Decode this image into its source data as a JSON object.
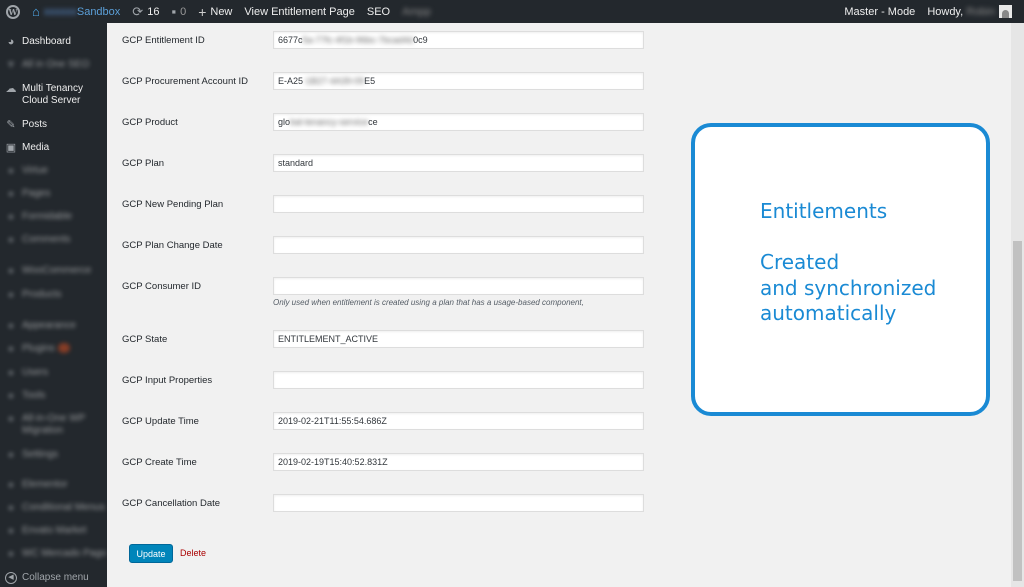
{
  "adminbar": {
    "site_name": "Sandbox",
    "updates_count": "16",
    "comments_count": "0",
    "new_label": "New",
    "view_page_label": "View Entitlement Page",
    "seo_label": "SEO",
    "blurred_item": "Ampp",
    "mode_label": "Master - Mode",
    "howdy_label": "Howdy,",
    "username": "Robin"
  },
  "sidebar": {
    "items": [
      {
        "label": "Dashboard",
        "icon": "dashboard-icon"
      },
      {
        "label": "All in One SEO",
        "icon": "shield-icon"
      },
      {
        "label": "Multi Tenancy Cloud Server",
        "icon": "cloud-icon"
      },
      {
        "label": "Posts",
        "icon": "pin-icon"
      },
      {
        "label": "Media",
        "icon": "media-icon"
      },
      {
        "label": "Virtue",
        "icon": "generic-icon"
      },
      {
        "label": "Pages",
        "icon": "page-icon"
      },
      {
        "label": "Formidable",
        "icon": "form-icon"
      },
      {
        "label": "Comments",
        "icon": "comment-icon"
      },
      {
        "label": "WooCommerce",
        "icon": "woo-icon"
      },
      {
        "label": "Products",
        "icon": "products-icon"
      },
      {
        "label": "Appearance",
        "icon": "brush-icon"
      },
      {
        "label": "Plugins",
        "icon": "plug-icon"
      },
      {
        "label": "Users",
        "icon": "users-icon"
      },
      {
        "label": "Tools",
        "icon": "tools-icon"
      },
      {
        "label": "All-in-One WP Migration",
        "icon": "migration-icon"
      },
      {
        "label": "Settings",
        "icon": "settings-icon"
      },
      {
        "label": "Elementor",
        "icon": "elementor-icon"
      },
      {
        "label": "Conditional Menus",
        "icon": "menus-icon"
      },
      {
        "label": "Envato Market",
        "icon": "envato-icon"
      },
      {
        "label": "WC Mercado Pago",
        "icon": "wc-icon"
      }
    ],
    "collapse_label": "Collapse menu"
  },
  "form": {
    "entitlement_id": {
      "label": "GCP Entitlement ID",
      "value_prefix": "6677c",
      "value_blur": "5a-77fc-4f1b-96bc-7bcad4d",
      "value_suffix": "0c9"
    },
    "procurement_account_id": {
      "label": "GCP Procurement Account ID",
      "value_prefix": "E-A25",
      "value_blur": "-1B27-4A39-09",
      "value_suffix": "E5"
    },
    "product": {
      "label": "GCP Product",
      "value_prefix": "glo",
      "value_blur": "bal-tenancy-service",
      "value_suffix": "ce"
    },
    "plan": {
      "label": "GCP Plan",
      "value": "standard"
    },
    "new_pending_plan": {
      "label": "GCP New Pending Plan",
      "value": ""
    },
    "plan_change_date": {
      "label": "GCP Plan Change Date",
      "value": ""
    },
    "consumer_id": {
      "label": "GCP Consumer ID",
      "value": "",
      "description": "Only used when entitlement is created using a plan that has a usage-based component,"
    },
    "state": {
      "label": "GCP State",
      "value": "ENTITLEMENT_ACTIVE"
    },
    "input_properties": {
      "label": "GCP Input Properties",
      "value": ""
    },
    "update_time": {
      "label": "GCP Update Time",
      "value": "2019-02-21T11:55:54.686Z"
    },
    "create_time": {
      "label": "GCP Create Time",
      "value": "2019-02-19T15:40:52.831Z"
    },
    "cancellation_date": {
      "label": "GCP Cancellation Date",
      "value": ""
    },
    "update_button": "Update",
    "delete_link": "Delete"
  },
  "callout": {
    "line1": "Entitlements",
    "line2": "Created",
    "line3": "and synchronized",
    "line4": "automatically"
  },
  "colors": {
    "adminbar_bg": "#23282d",
    "sidebar_bg": "#23282d",
    "content_bg": "#f1f1f1",
    "primary_button": "#0085ba",
    "delete_link": "#aa0000",
    "callout_accent": "#1a8ad4"
  }
}
